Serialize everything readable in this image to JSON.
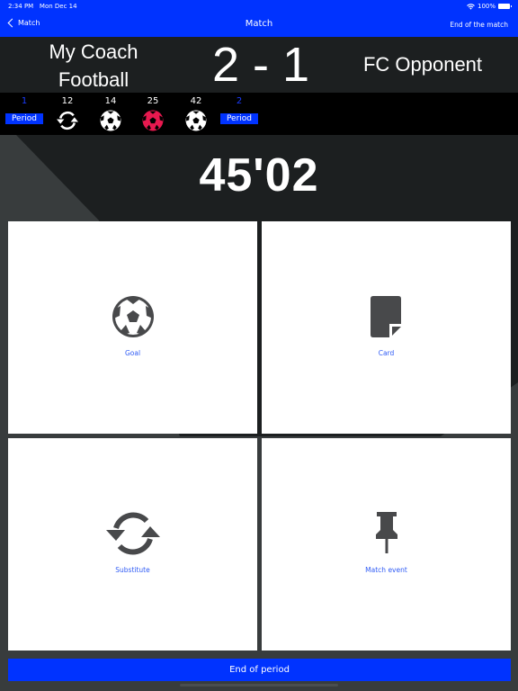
{
  "status_bar": {
    "time": "2:34 PM",
    "date": "Mon Dec 14",
    "battery": "100%"
  },
  "nav": {
    "back_label": "Match",
    "title": "Match",
    "right_action": "End of the match"
  },
  "scoreboard": {
    "home_team": "My Coach Football",
    "home_line1": "My Coach",
    "home_line2": "Football",
    "score": "2 - 1",
    "away_team": "FC Opponent"
  },
  "timeline": [
    {
      "minute": "1",
      "type": "period",
      "label": "Period"
    },
    {
      "minute": "12",
      "type": "substitute-icon"
    },
    {
      "minute": "14",
      "type": "goal-icon",
      "color": "#ffffff"
    },
    {
      "minute": "25",
      "type": "goal-icon",
      "color": "#e8194f"
    },
    {
      "minute": "42",
      "type": "goal-icon",
      "color": "#ffffff"
    },
    {
      "minute": "2",
      "type": "period",
      "label": "Period"
    }
  ],
  "timer": "45'02",
  "actions": [
    {
      "label": "Goal",
      "icon": "soccer-ball-icon"
    },
    {
      "label": "Card",
      "icon": "card-icon"
    },
    {
      "label": "Substitute",
      "icon": "substitute-icon"
    },
    {
      "label": "Match event",
      "icon": "pushpin-icon"
    }
  ],
  "end_period_label": "End of period",
  "colors": {
    "accent": "#0033ff",
    "dark": "#1c1f20",
    "background": "#383c3d",
    "icon": "#48494b",
    "label": "#2f5bf5",
    "opponent_goal": "#e8194f"
  }
}
